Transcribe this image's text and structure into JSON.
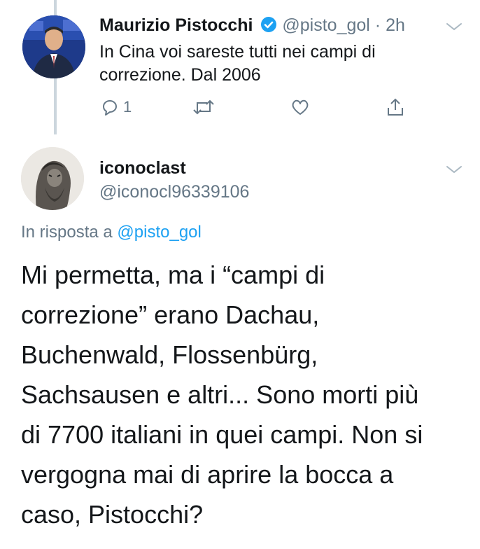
{
  "tweet1": {
    "name": "Maurizio Pistocchi",
    "handle": "@pisto_gol",
    "separator": "·",
    "time": "2h",
    "text_line1": "In Cina voi sareste tutti nei campi di",
    "text_line2": "correzione. Dal 2006",
    "reply_count": "1",
    "verified": true
  },
  "tweet2": {
    "name": "iconoclast",
    "handle": "@iconocl96339106",
    "reply_to_label": "In risposta a",
    "reply_to_handle": "@pisto_gol",
    "lines": [
      "Mi permetta, ma i “campi di",
      "correzione” erano Dachau,",
      "Buchenwald, Flossenbürg,",
      "Sachsausen e altri... Sono morti più",
      "di 7700 italiani in quei campi. Non si",
      "vergogna mai di aprire la bocca a",
      "caso, Pistocchi?"
    ]
  },
  "colors": {
    "accent": "#1da1f2",
    "secondary_text": "#657786",
    "thread_line": "#ccd6dd"
  }
}
